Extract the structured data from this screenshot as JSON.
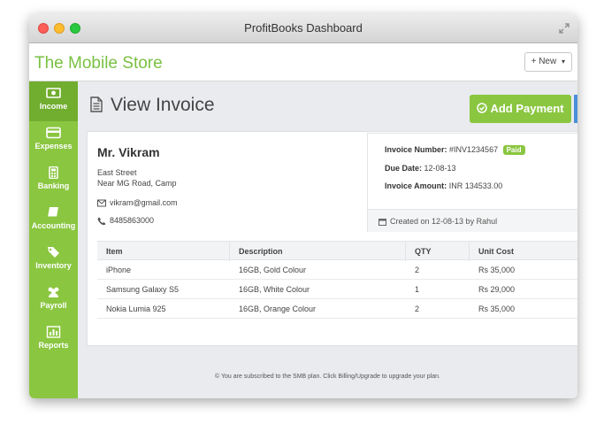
{
  "window": {
    "title": "ProfitBooks Dashboard"
  },
  "app": {
    "brand": "The Mobile Store",
    "new_button": "+ New"
  },
  "sidebar": {
    "items": [
      {
        "label": "Income",
        "icon": "money-icon",
        "active": true
      },
      {
        "label": "Expenses",
        "icon": "credit-card-icon",
        "active": false
      },
      {
        "label": "Banking",
        "icon": "calculator-icon",
        "active": false
      },
      {
        "label": "Accounting",
        "icon": "book-icon",
        "active": false
      },
      {
        "label": "Inventory",
        "icon": "tags-icon",
        "active": false
      },
      {
        "label": "Payroll",
        "icon": "users-icon",
        "active": false
      },
      {
        "label": "Reports",
        "icon": "bar-chart-icon",
        "active": false
      }
    ]
  },
  "page": {
    "title": "View Invoice",
    "add_payment": "Add Payment"
  },
  "customer": {
    "name": "Mr. Vikram",
    "address_line1": "East Street",
    "address_line2": "Near MG Road, Camp",
    "email": "vikram@gmail.com",
    "phone": "8485863000"
  },
  "invoice": {
    "number_label": "Invoice Number:",
    "number": "#INV1234567",
    "status": "Paid",
    "due_label": "Due Date:",
    "due_date": "12-08-13",
    "amount_label": "Invoice Amount:",
    "amount": "INR 134533.00",
    "created": "Created on 12-08-13 by Rahul"
  },
  "table": {
    "headers": {
      "item": "Item",
      "description": "Description",
      "qty": "QTY",
      "unit_cost": "Unit Cost"
    },
    "rows": [
      {
        "item": "iPhone",
        "description": "16GB, Gold Colour",
        "qty": "2",
        "unit_cost": "Rs 35,000"
      },
      {
        "item": "Samsung Galaxy S5",
        "description": "16GB, White Colour",
        "qty": "1",
        "unit_cost": "Rs 29,000"
      },
      {
        "item": "Nokia Lumia 925",
        "description": "16GB, Orange Colour",
        "qty": "2",
        "unit_cost": "Rs 35,000"
      }
    ]
  },
  "footer": {
    "note": "© You are subscribed to the SMB plan. Click Billing/Upgrade to upgrade your plan."
  },
  "colors": {
    "accent": "#8ac640",
    "accent_dark": "#71ad2e",
    "brand_text": "#7ac143"
  }
}
